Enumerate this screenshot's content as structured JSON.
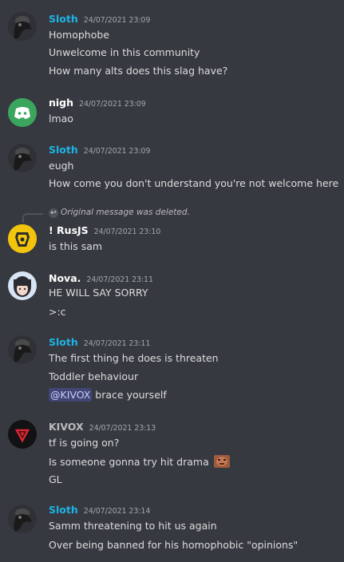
{
  "messages": [
    {
      "author": "Sloth",
      "author_color": "#1eb3e6",
      "timestamp": "24/07/2021 23:09",
      "lines": [
        "Homophobe",
        "Unwelcome in this community",
        "How many alts does this slag have?"
      ],
      "avatar": "plague-doctor-avatar"
    },
    {
      "author": "nigh",
      "author_color": "#ffffff",
      "timestamp": "24/07/2021 23:09",
      "lines": [
        "lmao"
      ],
      "avatar": "discord-default-avatar"
    },
    {
      "author": "Sloth",
      "author_color": "#1eb3e6",
      "timestamp": "24/07/2021 23:09",
      "lines": [
        "eugh",
        "How come you don't understand you're not welcome here"
      ],
      "avatar": "plague-doctor-avatar"
    },
    {
      "reply_text": "Original message was deleted.",
      "author": "! RusJS",
      "author_color": "#ffffff",
      "timestamp": "24/07/2021 23:10",
      "lines": [
        "is this sam"
      ],
      "avatar": "yellow-emblem-avatar"
    },
    {
      "author": "Nova.",
      "author_color": "#ffffff",
      "timestamp": "24/07/2021 23:11",
      "lines": [
        "HE WILL SAY SORRY",
        ">:c"
      ],
      "avatar": "anime-girl-avatar"
    },
    {
      "author": "Sloth",
      "author_color": "#1eb3e6",
      "timestamp": "24/07/2021 23:11",
      "lines": [
        "The first thing he does is threaten",
        "Toddler behaviour"
      ],
      "mention": "@KIVOX",
      "mention_rest": " brace yourself",
      "avatar": "plague-doctor-avatar"
    },
    {
      "author": "KIVOX",
      "author_color": "#b9bbbe",
      "timestamp": "24/07/2021 23:13",
      "lines": [
        "tf is going on?",
        "Is someone gonna try hit drama",
        "GL"
      ],
      "avatar": "red-triangle-avatar",
      "emoji": "face-emoji"
    },
    {
      "author": "Sloth",
      "author_color": "#1eb3e6",
      "timestamp": "24/07/2021 23:14",
      "lines": [
        "Samm threatening to hit us again",
        "Over being banned for his homophobic \"opinions\""
      ],
      "avatar": "plague-doctor-avatar"
    }
  ]
}
